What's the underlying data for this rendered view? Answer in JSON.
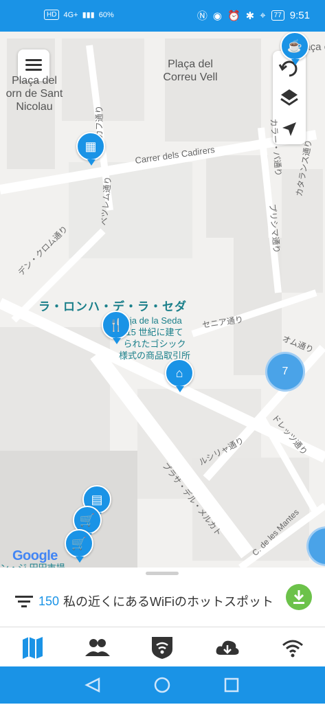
{
  "status": {
    "left_badges": [
      "HD",
      "4G+"
    ],
    "speed": "60%",
    "battery": "77",
    "time": "9:51"
  },
  "map": {
    "labels": {
      "placa_correu": "Plaça del\nCorreu Vell",
      "placa_born": "Plaça del\norn de Sant\nNicolau",
      "carrer_cadirers": "Carrer dels Cadirers",
      "rokafa": "・ロカフ通り",
      "kataransu": "カタランス通り",
      "karasu": "カラー・パ通り",
      "bethlem": "ベツレム通り",
      "plism": "プリシマ通り",
      "den_kurom": "デン・クロム通り",
      "sena": "セニア通り",
      "omu": "オム通り",
      "doretsu": "ドレッツ通り",
      "plasa_del_mercat": "プラサ・デル・メルカト",
      "luaria": "ルシリャ通り",
      "c_de_les_mantes": "C. de les Mantes",
      "placa_top_right": "Plaça ca"
    },
    "poi_title": "ラ・ロンハ・デ・ラ・セダ",
    "poi_desc": "tja de la Seda\n15 世紀に建て\nられたゴシック\n様式の商品取引所",
    "cluster_count": "7",
    "google": "Google",
    "bottom_cut_text": "ン・ジ 円田市場"
  },
  "icons": {
    "menu": "hamburger-menu-icon",
    "refresh": "refresh-icon",
    "layers": "layers-icon",
    "locate": "navigation-arrow-icon"
  },
  "sheet": {
    "count": "150",
    "title": "私の近くにあるWiFiのホットスポット"
  },
  "tabs": [
    "map-tab",
    "people-tab",
    "vpn-shield-tab",
    "download-tab",
    "wifi-tab"
  ],
  "colors": {
    "accent": "#1a93e6",
    "green": "#6cc24a",
    "teal_text": "#1a7f8a"
  }
}
